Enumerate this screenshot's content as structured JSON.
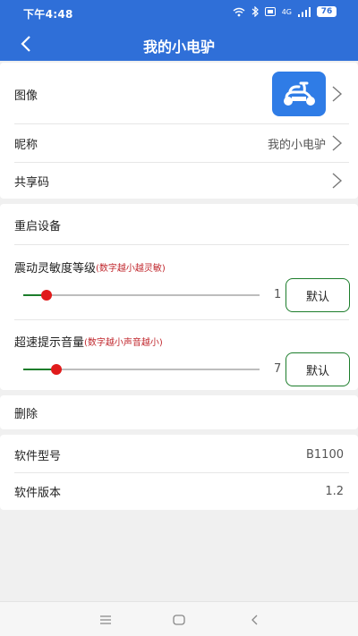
{
  "status": {
    "time": "下午4:48",
    "signal": "4G",
    "battery": "76"
  },
  "nav": {
    "title": "我的小电驴"
  },
  "profile": {
    "avatar_label": "图像",
    "nickname_label": "昵称",
    "nickname_value": "我的小电驴",
    "share_code_label": "共享码"
  },
  "device": {
    "restart_label": "重启设备",
    "vibration": {
      "label": "震动灵敏度等级",
      "hint": "(数字越小越灵敏)",
      "value": "1",
      "fraction": 0.1,
      "button": "默认"
    },
    "overspeed": {
      "label": "超速提示音量",
      "hint": "(数字越小声音越小)",
      "value": "7",
      "fraction": 0.14,
      "button": "默认"
    }
  },
  "delete_label": "删除",
  "software": {
    "model_label": "软件型号",
    "model_value": "B1100",
    "version_label": "软件版本",
    "version_value": "1.2"
  },
  "colors": {
    "primary": "#2f6fd8",
    "accent_green": "#1c7d2b",
    "thumb_red": "#e01b1b",
    "hint_red": "#c0272d"
  },
  "icons": {
    "back": "back-arrow-icon",
    "chevron": "chevron-right-icon",
    "scooter": "scooter-icon"
  }
}
